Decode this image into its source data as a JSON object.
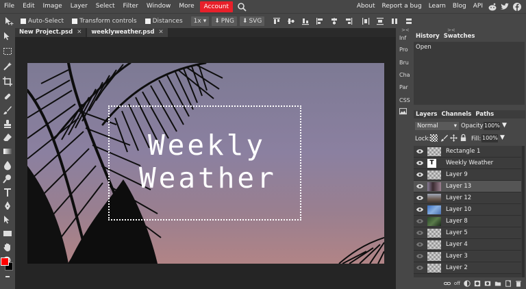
{
  "menubar": {
    "items": [
      "File",
      "Edit",
      "Image",
      "Layer",
      "Select",
      "Filter",
      "Window",
      "More",
      "Account"
    ],
    "right_items": [
      "About",
      "Report a bug",
      "Learn",
      "Blog",
      "API"
    ],
    "accent": "#e8202a"
  },
  "options": {
    "auto_select": "Auto-Select",
    "transform_controls": "Transform controls",
    "distances": "Distances",
    "scale": "1x",
    "png": "PNG",
    "svg": "SVG"
  },
  "doc_tabs": [
    {
      "label": "New Project.psd",
      "close": "✕"
    },
    {
      "label": "weeklyweather.psd",
      "close": "✕"
    }
  ],
  "canvas": {
    "line1": "Weekly",
    "line2": "Weather"
  },
  "side_minis": [
    "Inf",
    "Pro",
    "Bru",
    "Cha",
    "Par",
    "CSS"
  ],
  "history": {
    "tabs": [
      "History",
      "Swatches"
    ],
    "items": [
      "Open"
    ]
  },
  "layers_panel": {
    "tabs": [
      "Layers",
      "Channels",
      "Paths"
    ],
    "blend_mode": "Normal",
    "opacity_label": "Opacity:",
    "opacity_value": "100%",
    "lock_label": "Lock:",
    "fill_label": "Fill:",
    "fill_value": "100%",
    "layers": [
      {
        "name": "Rectangle 1",
        "thumb": "checker",
        "visible": true,
        "selected": false
      },
      {
        "name": "Weekly Weather",
        "thumb": "text",
        "visible": true,
        "selected": false
      },
      {
        "name": "Layer 9",
        "thumb": "checker",
        "visible": true,
        "selected": false
      },
      {
        "name": "Layer 13",
        "thumb": "photo",
        "visible": true,
        "selected": true
      },
      {
        "name": "Layer 12",
        "thumb": "photo2",
        "visible": true,
        "selected": false
      },
      {
        "name": "Layer 10",
        "thumb": "photo3",
        "visible": true,
        "selected": false
      },
      {
        "name": "Layer 8",
        "thumb": "photo4",
        "visible": false,
        "selected": false
      },
      {
        "name": "Layer 5",
        "thumb": "checker",
        "visible": false,
        "selected": false
      },
      {
        "name": "Layer 4",
        "thumb": "checker",
        "visible": false,
        "selected": false
      },
      {
        "name": "Layer 3",
        "thumb": "checker",
        "visible": false,
        "selected": false
      },
      {
        "name": "Layer 2",
        "thumb": "checker",
        "visible": false,
        "selected": false
      }
    ],
    "footer_off": "off"
  },
  "colors": {
    "foreground": "#ff0000",
    "background": "#000000"
  }
}
